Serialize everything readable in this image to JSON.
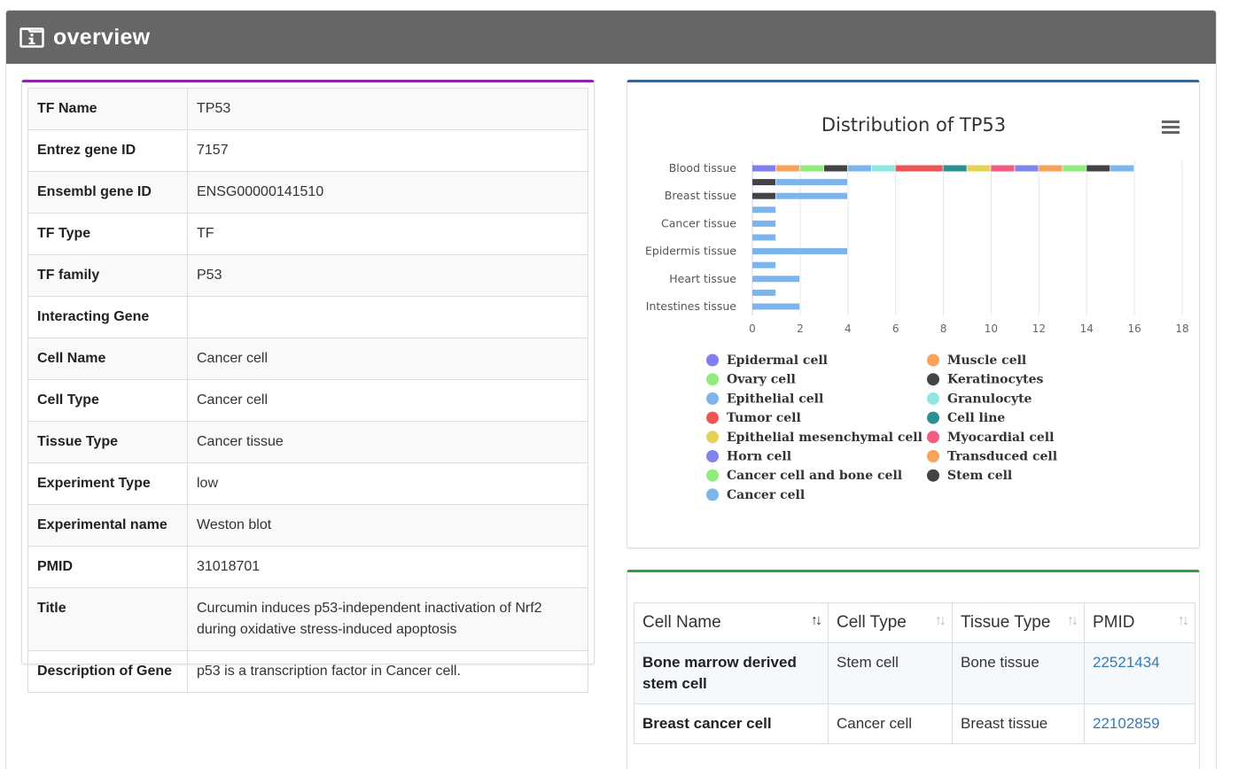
{
  "header": {
    "title": "overview",
    "icon": "info-folder-icon"
  },
  "info_table": {
    "rows": [
      {
        "key": "TF Name",
        "value": "TP53",
        "style": "red"
      },
      {
        "key": "Entrez gene ID",
        "value": "7157"
      },
      {
        "key": "Ensembl gene ID",
        "value": "ENSG00000141510"
      },
      {
        "key": "TF Type",
        "value": "TF"
      },
      {
        "key": "TF family",
        "value": "P53"
      },
      {
        "key": "Interacting Gene",
        "value": ""
      },
      {
        "key": "Cell Name",
        "value": "Cancer cell"
      },
      {
        "key": "Cell Type",
        "value": "Cancer cell"
      },
      {
        "key": "Tissue Type",
        "value": "Cancer tissue"
      },
      {
        "key": "Experiment Type",
        "value": "low"
      },
      {
        "key": "Experimental name",
        "value": "Weston blot"
      },
      {
        "key": "PMID",
        "value": "31018701",
        "style": "link"
      },
      {
        "key": "Title",
        "value": "Curcumin induces p53-independent inactivation of Nrf2 during oxidative stress-induced apoptosis"
      },
      {
        "key": "Description of Gene",
        "value": "p53 is a transcription factor in Cancer cell."
      }
    ]
  },
  "chart_data": {
    "type": "bar",
    "orientation": "horizontal",
    "stacked": true,
    "title": "Distribution of TP53",
    "menu_icon": "hamburger-menu-icon",
    "xlim": [
      0,
      18
    ],
    "xticks": [
      0,
      2,
      4,
      6,
      8,
      10,
      12,
      14,
      16,
      18
    ],
    "grid": true,
    "legend_position": "bottom",
    "categories": [
      "Blood tissue",
      "",
      "Breast tissue",
      "",
      "Cancer tissue",
      "",
      "Epidermis tissue",
      "",
      "Heart tissue",
      "",
      "Intestines tissue"
    ],
    "category_labels_shown": [
      "Blood tissue",
      "Breast tissue",
      "Cancer tissue",
      "Epidermis tissue",
      "Heart tissue",
      "Intestines tissue"
    ],
    "series": [
      {
        "name": "Epidermal cell",
        "color": "#7f7fef"
      },
      {
        "name": "Muscle cell",
        "color": "#f7a35c"
      },
      {
        "name": "Ovary cell",
        "color": "#90ed7d"
      },
      {
        "name": "Keratinocytes",
        "color": "#434348"
      },
      {
        "name": "Epithelial cell",
        "color": "#7cb5ec"
      },
      {
        "name": "Granulocyte",
        "color": "#8ee8e0"
      },
      {
        "name": "Tumor cell",
        "color": "#ef5555"
      },
      {
        "name": "Cell line",
        "color": "#2b908f"
      },
      {
        "name": "Epithelial mesenchymal cell",
        "color": "#e4d354"
      },
      {
        "name": "Myocardial cell",
        "color": "#f15c80"
      },
      {
        "name": "Horn cell",
        "color": "#8085e9"
      },
      {
        "name": "Transduced cell",
        "color": "#f7a35c"
      },
      {
        "name": "Cancer cell and bone cell",
        "color": "#90ed7d"
      },
      {
        "name": "Stem cell",
        "color": "#434348"
      },
      {
        "name": "Cancer cell",
        "color": "#7cb5ec"
      }
    ],
    "bars": [
      {
        "row": 0,
        "segments": [
          [
            "Epidermal cell",
            1
          ],
          [
            "Muscle cell",
            1
          ],
          [
            "Ovary cell",
            1
          ],
          [
            "Keratinocytes",
            1
          ],
          [
            "Epithelial cell",
            1
          ],
          [
            "Granulocyte",
            1
          ],
          [
            "Tumor cell",
            2
          ],
          [
            "Cell line",
            1
          ],
          [
            "Epithelial mesenchymal cell",
            1
          ],
          [
            "Myocardial cell",
            1
          ],
          [
            "Horn cell",
            1
          ],
          [
            "Transduced cell",
            1
          ],
          [
            "Cancer cell and bone cell",
            1
          ],
          [
            "Stem cell",
            1
          ],
          [
            "Cancer cell",
            1
          ]
        ]
      },
      {
        "row": 1,
        "segments": [
          [
            "Keratinocytes",
            1
          ],
          [
            "Cancer cell",
            3
          ]
        ]
      },
      {
        "row": 2,
        "segments": [
          [
            "Keratinocytes",
            1
          ],
          [
            "Cancer cell",
            3
          ]
        ]
      },
      {
        "row": 3,
        "segments": [
          [
            "Cancer cell",
            1
          ]
        ]
      },
      {
        "row": 4,
        "segments": [
          [
            "Cancer cell",
            1
          ]
        ]
      },
      {
        "row": 5,
        "segments": [
          [
            "Cancer cell",
            1
          ]
        ]
      },
      {
        "row": 6,
        "segments": [
          [
            "Cancer cell",
            4
          ]
        ]
      },
      {
        "row": 7,
        "segments": [
          [
            "Cancer cell",
            1
          ]
        ]
      },
      {
        "row": 8,
        "segments": [
          [
            "Cancer cell",
            2
          ]
        ]
      },
      {
        "row": 9,
        "segments": [
          [
            "Cancer cell",
            1
          ]
        ]
      },
      {
        "row": 10,
        "segments": [
          [
            "Cancer cell",
            2
          ]
        ]
      }
    ],
    "legend_order": [
      "Epidermal cell",
      "Muscle cell",
      "Ovary cell",
      "Keratinocytes",
      "Epithelial cell",
      "Granulocyte",
      "Tumor cell",
      "Cell line",
      "Epithelial mesenchymal cell",
      "Myocardial cell",
      "Horn cell",
      "Transduced cell",
      "Cancer cell and bone cell",
      "Stem cell",
      "Cancer cell"
    ]
  },
  "cell_table": {
    "headers": [
      "Cell Name",
      "Cell Type",
      "Tissue Type",
      "PMID"
    ],
    "rows": [
      [
        "Bone marrow derived stem cell",
        "Stem cell",
        "Bone tissue",
        "22521434"
      ],
      [
        "Breast cancer cell",
        "Cancer cell",
        "Breast tissue",
        "22102859"
      ]
    ]
  }
}
